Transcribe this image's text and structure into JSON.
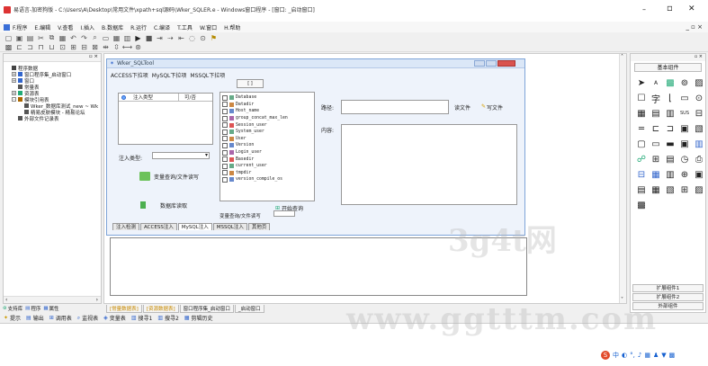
{
  "window": {
    "title": "易语言-加密狗版 - C:\\Users\\A\\Desktop\\常用文件\\xpath+sql源码\\Wker_SQLER.e - Windows窗口程序 - [窗口: _启动窗口]",
    "controls": {
      "minimize": "–",
      "maximize": "▫",
      "close": "✕"
    },
    "inner_controls": "_ ▫ ×"
  },
  "menubar": {
    "items": [
      "F.程序",
      "E.编辑",
      "V.查看",
      "I.插入",
      "B.数据库",
      "R.运行",
      "C.编译",
      "T.工具",
      "W.窗口",
      "H.帮助"
    ]
  },
  "left_panel": {
    "title_controls": "▫ ×",
    "tree": [
      {
        "label": "程序数据",
        "level": 0,
        "expander": "",
        "icon": "program-icon"
      },
      {
        "label": "窗口程序集_启动窗口",
        "level": 1,
        "expander": "+",
        "icon": "window-icon"
      },
      {
        "label": "窗口",
        "level": 1,
        "expander": "+",
        "icon": "window-icon"
      },
      {
        "label": "常量表",
        "level": 1,
        "expander": "",
        "icon": "constant-icon"
      },
      {
        "label": "资源表",
        "level": 1,
        "expander": "+",
        "icon": "resource-icon"
      },
      {
        "label": "模块引用表",
        "level": 1,
        "expander": "-",
        "icon": "module-icon"
      },
      {
        "label": "Wker_数据库测试_new ~ Wk",
        "level": 2,
        "expander": "",
        "icon": "file-icon"
      },
      {
        "label": "精易皮肤模块 - 精易论坛",
        "level": 2,
        "expander": "",
        "icon": "file-icon"
      },
      {
        "label": "外部文件记录表",
        "level": 1,
        "expander": "",
        "icon": "file-icon"
      }
    ],
    "bottom_tabs": [
      "支持库",
      "程序",
      "属性"
    ]
  },
  "design_window": {
    "title": "Wker_SQLTool",
    "top_tabs": [
      "ACCESS下拉项",
      "MySQL下拉项",
      "MSSQL下拉项"
    ],
    "header_button": "[ ]",
    "list_header": {
      "col1": "注入类型",
      "col2": "可/否"
    },
    "inject_type_label": "注入类型:",
    "variable_button": "变量查询/文件读写",
    "db_read_label": "数据库读取",
    "db_items": [
      "Database",
      "Datadir",
      "Host_name",
      "group_concat_max_len",
      "Session_user",
      "System_user",
      "User",
      "Version",
      "Login_user",
      "Basedir",
      "current_user",
      "tmpdir",
      "version_compile_os"
    ],
    "path_label": "路径:",
    "read_file_label": "读文件",
    "write_file_label": "写文件",
    "content_label": "内容:",
    "start_query_button": "开始查询",
    "var_query_label": "变量查询/文件读写",
    "bottom_tabs": [
      "注入检测",
      "ACCESS注入",
      "MySQL注入",
      "MSSQL注入",
      "其他页"
    ]
  },
  "editor_tabs": [
    "[常量数据表]",
    "[资源数据表]",
    "窗口程序集_启动窗口",
    "_启动窗口"
  ],
  "right_panel": {
    "title_controls": "▫ ×",
    "header": "基本组件",
    "footer_tabs": [
      "扩展组件1",
      "扩展组件2",
      "外部组件"
    ]
  },
  "output_tabs": [
    "提示",
    "输出",
    "调用表",
    "监视表",
    "变量表",
    "搜寻1",
    "搜寻2",
    "剪辑历史"
  ],
  "watermark": {
    "line1": "3g4t网",
    "line2": "www.ggtttm.com"
  }
}
